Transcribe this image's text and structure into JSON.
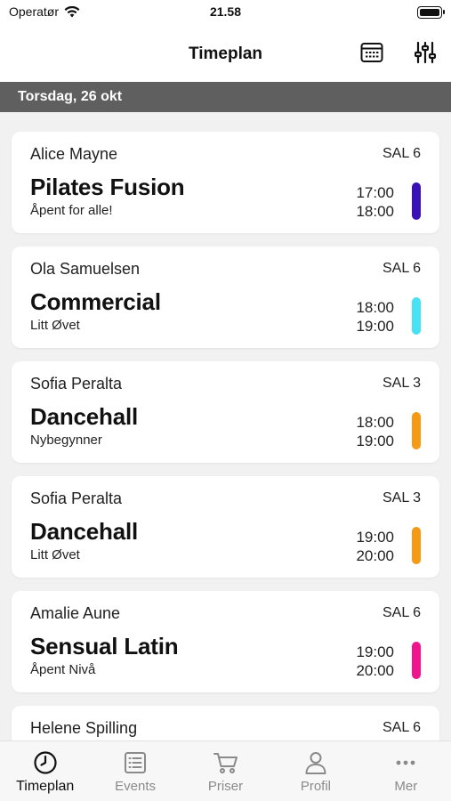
{
  "status_bar": {
    "carrier": "Operatør",
    "time": "21.58"
  },
  "nav": {
    "title": "Timeplan"
  },
  "date_header": "Torsdag, 26 okt",
  "sessions": [
    {
      "instructor": "Alice Mayne",
      "room": "SAL 6",
      "class_name": "Pilates Fusion",
      "level": "Åpent for alle!",
      "start": "17:00",
      "end": "18:00",
      "color": "#3a10b8"
    },
    {
      "instructor": "Ola Samuelsen",
      "room": "SAL 6",
      "class_name": "Commercial",
      "level": "Litt Øvet",
      "start": "18:00",
      "end": "19:00",
      "color": "#45e3f5"
    },
    {
      "instructor": "Sofia Peralta",
      "room": "SAL 3",
      "class_name": "Dancehall",
      "level": "Nybegynner",
      "start": "18:00",
      "end": "19:00",
      "color": "#f59a14"
    },
    {
      "instructor": "Sofia Peralta",
      "room": "SAL 3",
      "class_name": "Dancehall",
      "level": "Litt Øvet",
      "start": "19:00",
      "end": "20:00",
      "color": "#f59a14"
    },
    {
      "instructor": "Amalie Aune",
      "room": "SAL 6",
      "class_name": "Sensual Latin",
      "level": "Åpent Nivå",
      "start": "19:00",
      "end": "20:00",
      "color": "#f0148f"
    },
    {
      "instructor": "Helene Spilling",
      "room": "SAL 6",
      "class_name": "",
      "level": "",
      "start": "",
      "end": "",
      "color": "#ffffff"
    }
  ],
  "tabs": [
    {
      "label": "Timeplan",
      "icon": "clock-icon",
      "active": true
    },
    {
      "label": "Events",
      "icon": "list-icon",
      "active": false
    },
    {
      "label": "Priser",
      "icon": "cart-icon",
      "active": false
    },
    {
      "label": "Profil",
      "icon": "person-icon",
      "active": false
    },
    {
      "label": "Mer",
      "icon": "more-icon",
      "active": false
    }
  ]
}
